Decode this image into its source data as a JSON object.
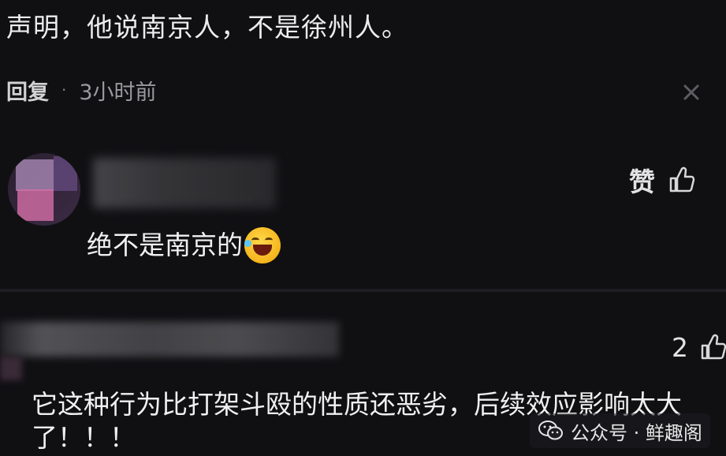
{
  "top_comment": {
    "text": "声明，他说南京人，不是徐州人。",
    "reply_label": "回复",
    "separator": "·",
    "time": "3小时前"
  },
  "comment_1": {
    "like_label": "赞",
    "text": "绝不是南京的",
    "emoji": "laughing-with-tears-icon"
  },
  "comment_2": {
    "like_count": "2",
    "text": "它这种行为比打架斗殴的性质还恶劣，后续效应影响太大了！！！"
  },
  "watermark": {
    "text": "公众号 · 鲜趣阁"
  },
  "colors": {
    "background": "#101013",
    "text": "#f0f0f0",
    "muted": "#9a9a9e"
  }
}
